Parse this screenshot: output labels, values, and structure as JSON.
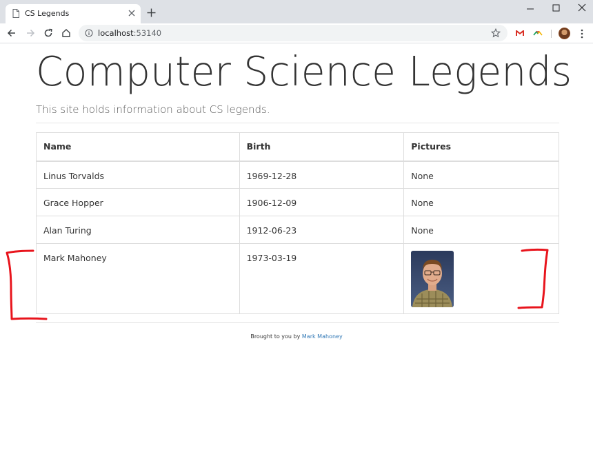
{
  "browser": {
    "tab_title": "CS Legends",
    "url_host": "localhost",
    "url_port": ":53140"
  },
  "page": {
    "title": "Computer Science Legends",
    "subtitle": "This site holds information about CS legends."
  },
  "table": {
    "headers": [
      "Name",
      "Birth",
      "Pictures"
    ],
    "rows": [
      {
        "name": "Linus Torvalds",
        "birth": "1969-12-28",
        "pictures": "None"
      },
      {
        "name": "Grace Hopper",
        "birth": "1906-12-09",
        "pictures": "None"
      },
      {
        "name": "Alan Turing",
        "birth": "1912-06-23",
        "pictures": "None"
      },
      {
        "name": "Mark Mahoney",
        "birth": "1973-03-19",
        "pictures": ""
      }
    ]
  },
  "footer": {
    "prefix": "Brought to you by ",
    "link": "Mark Mahoney"
  },
  "colors": {
    "annotation": "#e8141c",
    "link": "#337ab7"
  }
}
